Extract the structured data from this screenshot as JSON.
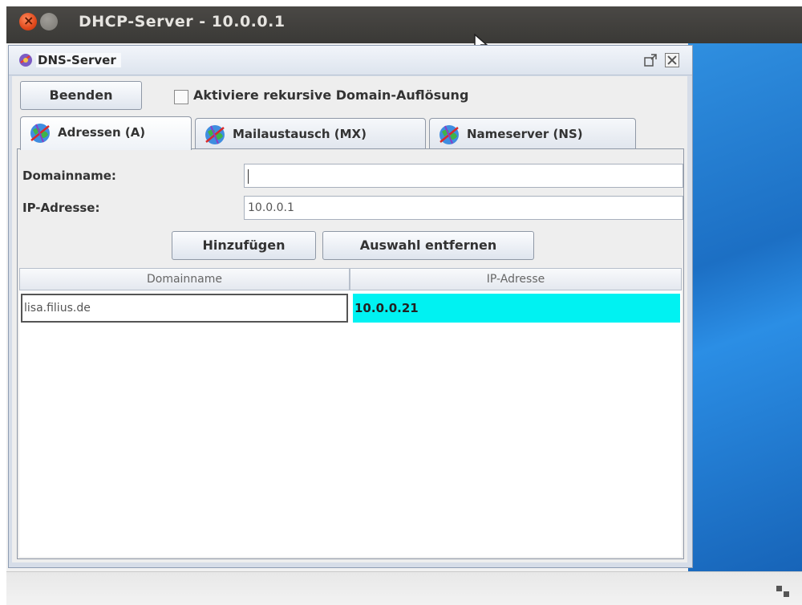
{
  "window": {
    "title": "DHCP-Server - 10.0.0.1"
  },
  "internal_frame": {
    "title": "DNS-Server"
  },
  "toolbar": {
    "beenden_label": "Beenden",
    "recursive_label": "Aktiviere rekursive Domain-Auflösung",
    "recursive_checked": false
  },
  "tabs": [
    {
      "label": "Adressen (A)",
      "active": true
    },
    {
      "label": "Mailaustausch (MX)",
      "active": false
    },
    {
      "label": "Nameserver (NS)",
      "active": false
    }
  ],
  "form": {
    "domain_label": "Domainname:",
    "domain_value": "",
    "ip_label": "IP-Adresse:",
    "ip_value": "10.0.0.1",
    "add_label": "Hinzufügen",
    "remove_label": "Auswahl entfernen"
  },
  "table": {
    "columns": [
      "Domainname",
      "IP-Adresse"
    ],
    "rows": [
      {
        "domain": "lisa.filius.de",
        "ip": "10.0.0.21"
      }
    ]
  },
  "colors": {
    "selected_cell": "#00f2f2",
    "desktop": "#1c6fc4"
  }
}
